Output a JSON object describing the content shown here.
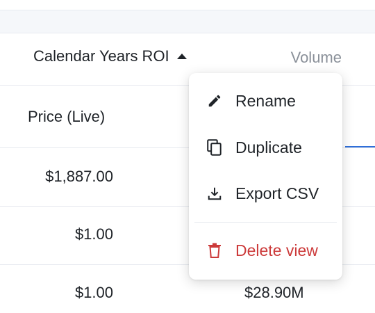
{
  "table": {
    "headers": {
      "roi": "Calendar Years ROI",
      "volume": "Volume",
      "price": "Price (Live)"
    },
    "rows": [
      {
        "price": "$1,887.00",
        "volume": ""
      },
      {
        "price": "$1.00",
        "volume": ""
      },
      {
        "price": "$1.00",
        "volume": "$28.90M"
      }
    ]
  },
  "menu": {
    "items": [
      {
        "label": "Rename",
        "icon": "pencil-icon"
      },
      {
        "label": "Duplicate",
        "icon": "copy-icon"
      },
      {
        "label": "Export CSV",
        "icon": "download-icon"
      },
      {
        "label": "Delete view",
        "icon": "trash-icon"
      }
    ]
  },
  "colors": {
    "danger": "#cc3a3a",
    "accent": "#2f6fd9",
    "muted_text": "#8a9099"
  }
}
